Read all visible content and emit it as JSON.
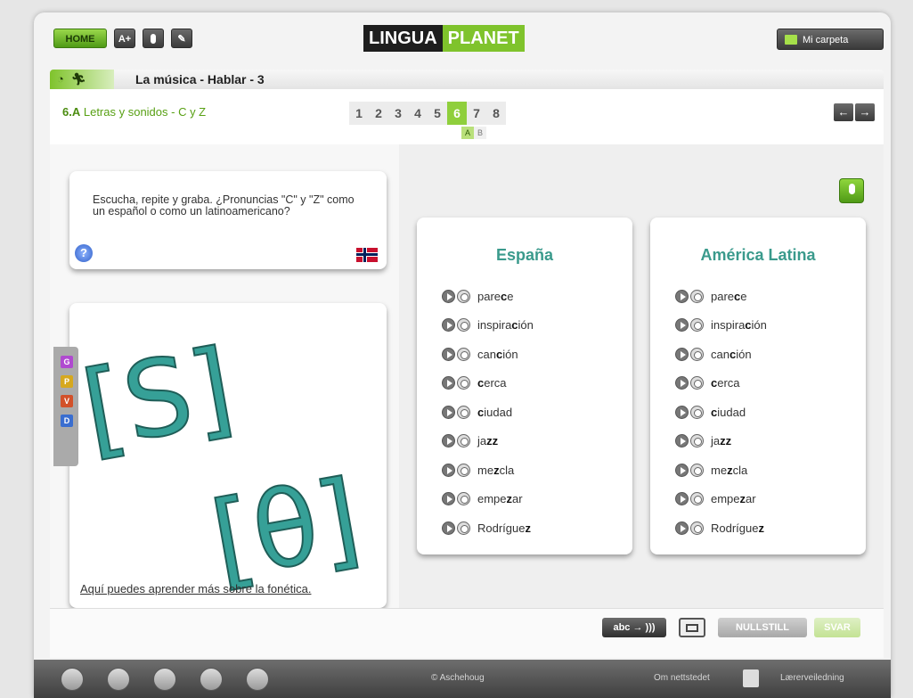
{
  "topbar": {
    "home_label": "HOME",
    "font_label": "A+",
    "logo_part1": "LINGUA",
    "logo_part2": "PLANET",
    "folder_label": "Mi carpeta"
  },
  "lesson": {
    "title": "La música - Hablar - 3",
    "section_num": "6.A",
    "section_title": "Letras y sonidos - C y Z"
  },
  "pages": [
    "1",
    "2",
    "3",
    "4",
    "5",
    "6",
    "7",
    "8"
  ],
  "active_page": "6",
  "subpages": [
    "A",
    "B"
  ],
  "active_subpage": "A",
  "nav": {
    "prev": "←",
    "next": "→"
  },
  "instruction": {
    "text": "Escucha, repite y graba. ¿Pronuncias \"C\" y \"Z\"  como un español o como un latinoamericano?",
    "help": "?"
  },
  "phonetics": {
    "symbol1": "[S]",
    "symbol2": "[θ]",
    "link": "Aquí puedes aprender más sobre la fonética."
  },
  "side_tabs": [
    {
      "label": "G",
      "color": "#b04ad0"
    },
    {
      "label": "P",
      "color": "#d6a81e"
    },
    {
      "label": "V",
      "color": "#d2512a"
    },
    {
      "label": "D",
      "color": "#3a6ed0"
    }
  ],
  "columns": [
    {
      "title": "España",
      "words": [
        {
          "pre": "pare",
          "bold": "c",
          "post": "e"
        },
        {
          "pre": "inspira",
          "bold": "c",
          "post": "ión"
        },
        {
          "pre": "can",
          "bold": "c",
          "post": "ión"
        },
        {
          "pre": "",
          "bold": "c",
          "post": "erca"
        },
        {
          "pre": "",
          "bold": "c",
          "post": "iudad"
        },
        {
          "pre": "ja",
          "bold": "zz",
          "post": ""
        },
        {
          "pre": "me",
          "bold": "z",
          "post": "cla"
        },
        {
          "pre": "empe",
          "bold": "z",
          "post": "ar"
        },
        {
          "pre": "Rodrígue",
          "bold": "z",
          "post": ""
        }
      ]
    },
    {
      "title": "América Latina",
      "words": [
        {
          "pre": "pare",
          "bold": "c",
          "post": "e"
        },
        {
          "pre": "inspira",
          "bold": "c",
          "post": "ión"
        },
        {
          "pre": "can",
          "bold": "c",
          "post": "ión"
        },
        {
          "pre": "",
          "bold": "c",
          "post": "erca"
        },
        {
          "pre": "",
          "bold": "c",
          "post": "iudad"
        },
        {
          "pre": "ja",
          "bold": "zz",
          "post": ""
        },
        {
          "pre": "me",
          "bold": "z",
          "post": "cla"
        },
        {
          "pre": "empe",
          "bold": "z",
          "post": "ar"
        },
        {
          "pre": "Rodrígue",
          "bold": "z",
          "post": ""
        }
      ]
    }
  ],
  "bottom": {
    "abc_label": "abc → )))",
    "reset_label": "NULLSTILL",
    "answer_label": "SVAR"
  },
  "footer": {
    "copyright": "© Aschehoug",
    "about": "Om nettstedet",
    "teacher_guide": "Lærerveiledning"
  },
  "colors": {
    "accent": "#7fc32c",
    "teal": "#3a9a8c"
  }
}
